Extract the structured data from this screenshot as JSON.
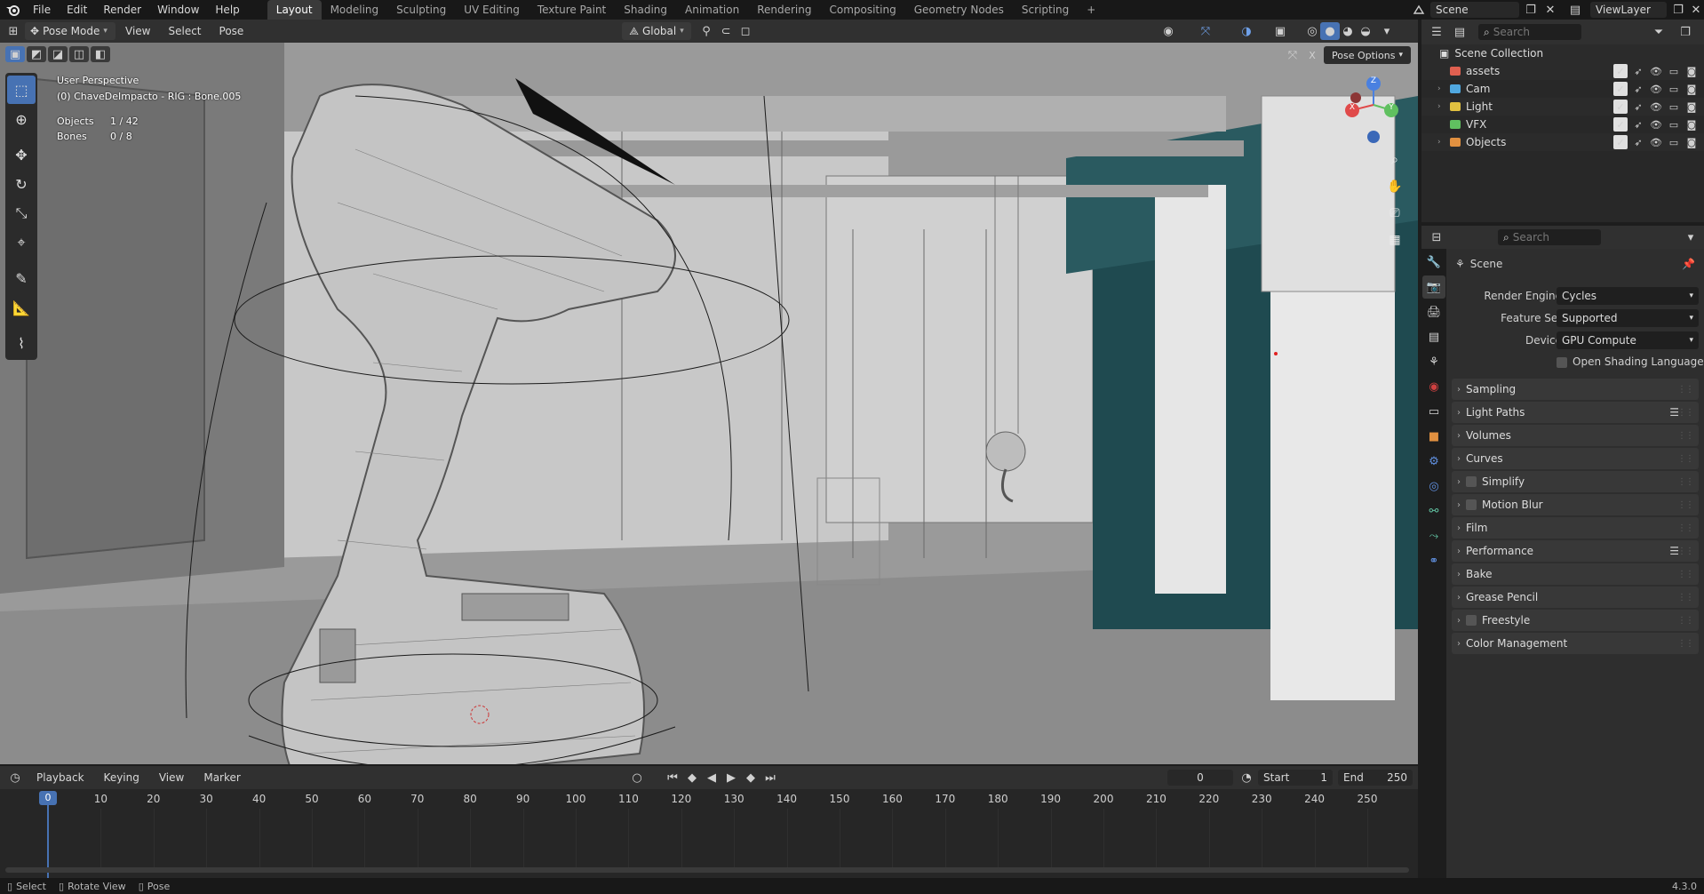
{
  "menubar": {
    "items": [
      "File",
      "Edit",
      "Render",
      "Window",
      "Help"
    ],
    "workspaces": [
      "Layout",
      "Modeling",
      "Sculpting",
      "UV Editing",
      "Texture Paint",
      "Shading",
      "Animation",
      "Rendering",
      "Compositing",
      "Geometry Nodes",
      "Scripting"
    ],
    "active_workspace": "Layout",
    "add_tab": "+",
    "scene_label": "Scene",
    "viewlayer_label": "ViewLayer"
  },
  "viewport_header": {
    "mode": "Pose Mode",
    "menus": [
      "View",
      "Select",
      "Pose"
    ],
    "orientation": "Global",
    "pose_options": "Pose Options"
  },
  "viewport_overlay": {
    "perspective": "User Perspective",
    "active_object": "(0) ChaveDeImpacto - RIG : Bone.005",
    "objects_label": "Objects",
    "objects_value": "1 / 42",
    "bones_label": "Bones",
    "bones_value": "0 / 8",
    "gizmo_axes": {
      "x": "X",
      "y": "Y",
      "z": "Z"
    }
  },
  "timeline": {
    "menus": [
      "Playback",
      "Keying",
      "View",
      "Marker"
    ],
    "current_frame": "0",
    "start_label": "Start",
    "start_value": "1",
    "end_label": "End",
    "end_value": "250",
    "ticks": [
      "0",
      "10",
      "20",
      "30",
      "40",
      "50",
      "60",
      "70",
      "80",
      "90",
      "100",
      "110",
      "120",
      "130",
      "140",
      "150",
      "160",
      "170",
      "180",
      "190",
      "200",
      "210",
      "220",
      "230",
      "240",
      "250"
    ],
    "playhead": "0"
  },
  "statusbar": {
    "items": [
      "Select",
      "Rotate View",
      "Pose"
    ],
    "version": "4.3.0"
  },
  "outliner": {
    "search_placeholder": "Search",
    "root": "Scene Collection",
    "collections": [
      {
        "name": "assets",
        "color": "#e06050"
      },
      {
        "name": "Cam",
        "color": "#50a8e0"
      },
      {
        "name": "Light",
        "color": "#e0c040"
      },
      {
        "name": "VFX",
        "color": "#60c060"
      },
      {
        "name": "Objects",
        "color": "#e09040"
      }
    ]
  },
  "properties": {
    "search_placeholder": "Search",
    "context": "Scene",
    "render_engine_label": "Render Engine",
    "render_engine": "Cycles",
    "feature_set_label": "Feature Set",
    "feature_set": "Supported",
    "device_label": "Device",
    "device": "GPU Compute",
    "osl_label": "Open Shading Language",
    "panels": [
      "Sampling",
      "Light Paths",
      "Volumes",
      "Curves",
      "Simplify",
      "Motion Blur",
      "Film",
      "Performance",
      "Bake",
      "Grease Pencil",
      "Freestyle",
      "Color Management"
    ]
  },
  "colors": {
    "accent": "#4772b3",
    "playhead": "#4772b3",
    "teal_wall": "#1f4a50"
  }
}
